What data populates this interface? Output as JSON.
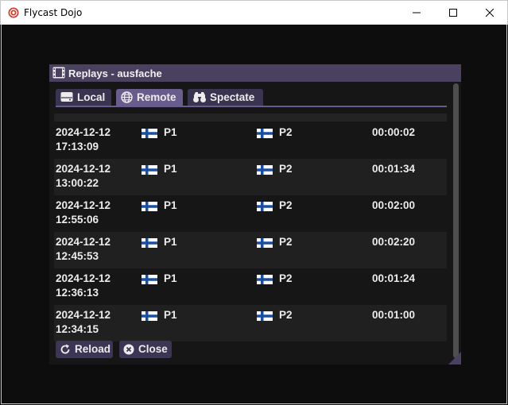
{
  "window": {
    "title": "Flycast Dojo",
    "controls": [
      "minimize-icon",
      "maximize-icon",
      "close-icon"
    ]
  },
  "dialog": {
    "title": "Replays - ausfache",
    "title_icon": "film-icon"
  },
  "tabs": [
    {
      "label": "Local",
      "icon": "hard-drive-icon",
      "active": false
    },
    {
      "label": "Remote",
      "icon": "globe-icon",
      "active": true
    },
    {
      "label": "Spectate",
      "icon": "binoculars-icon",
      "active": false
    }
  ],
  "replays": [
    {
      "date": "2024-12-12",
      "time": "17:13:09",
      "p1": "P1",
      "p2": "P2",
      "duration": "00:00:02",
      "flag": "finland-flag-icon"
    },
    {
      "date": "2024-12-12",
      "time": "13:00:22",
      "p1": "P1",
      "p2": "P2",
      "duration": "00:01:34",
      "flag": "finland-flag-icon"
    },
    {
      "date": "2024-12-12",
      "time": "12:55:06",
      "p1": "P1",
      "p2": "P2",
      "duration": "00:02:00",
      "flag": "finland-flag-icon"
    },
    {
      "date": "2024-12-12",
      "time": "12:45:53",
      "p1": "P1",
      "p2": "P2",
      "duration": "00:02:20",
      "flag": "finland-flag-icon"
    },
    {
      "date": "2024-12-12",
      "time": "12:36:13",
      "p1": "P1",
      "p2": "P2",
      "duration": "00:01:24",
      "flag": "finland-flag-icon"
    },
    {
      "date": "2024-12-12",
      "time": "12:34:15",
      "p1": "P1",
      "p2": "P2",
      "duration": "00:01:00",
      "flag": "finland-flag-icon"
    }
  ],
  "buttons": {
    "reload": {
      "label": "Reload",
      "icon": "reload-icon"
    },
    "close": {
      "label": "Close",
      "icon": "close-circle-icon"
    }
  },
  "colors": {
    "title_bg": "#4a4160",
    "tab_active": "#685c8c",
    "tab_inactive": "#3a3450",
    "button_bg": "#3c3553",
    "flag_blue": "#1a4fa0"
  }
}
